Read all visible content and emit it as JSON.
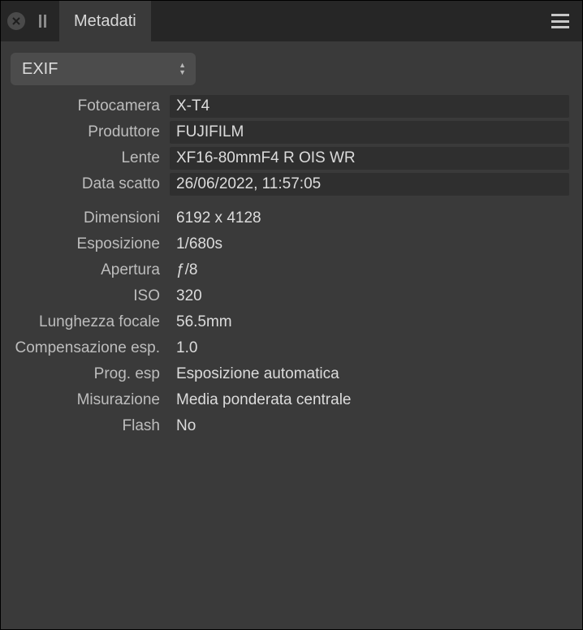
{
  "header": {
    "tab_label": "Metadati"
  },
  "dropdown": {
    "selected": "EXIF"
  },
  "fields": {
    "camera_label": "Fotocamera",
    "camera_value": "X-T4",
    "maker_label": "Produttore",
    "maker_value": "FUJIFILM",
    "lens_label": "Lente",
    "lens_value": "XF16-80mmF4 R OIS WR",
    "date_label": "Data scatto",
    "date_value": "26/06/2022,  11:57:05",
    "dimensions_label": "Dimensioni",
    "dimensions_value": "6192 x 4128",
    "exposure_label": "Esposizione",
    "exposure_value": "1/680s",
    "aperture_label": "Apertura",
    "aperture_value": "ƒ/8",
    "iso_label": "ISO",
    "iso_value": "320",
    "focal_label": "Lunghezza focale",
    "focal_value": "56.5mm",
    "comp_label": "Compensazione esp.",
    "comp_value": "1.0",
    "prog_label": "Prog. esp",
    "prog_value": "Esposizione automatica",
    "meter_label": "Misurazione",
    "meter_value": "Media ponderata centrale",
    "flash_label": "Flash",
    "flash_value": "No"
  }
}
